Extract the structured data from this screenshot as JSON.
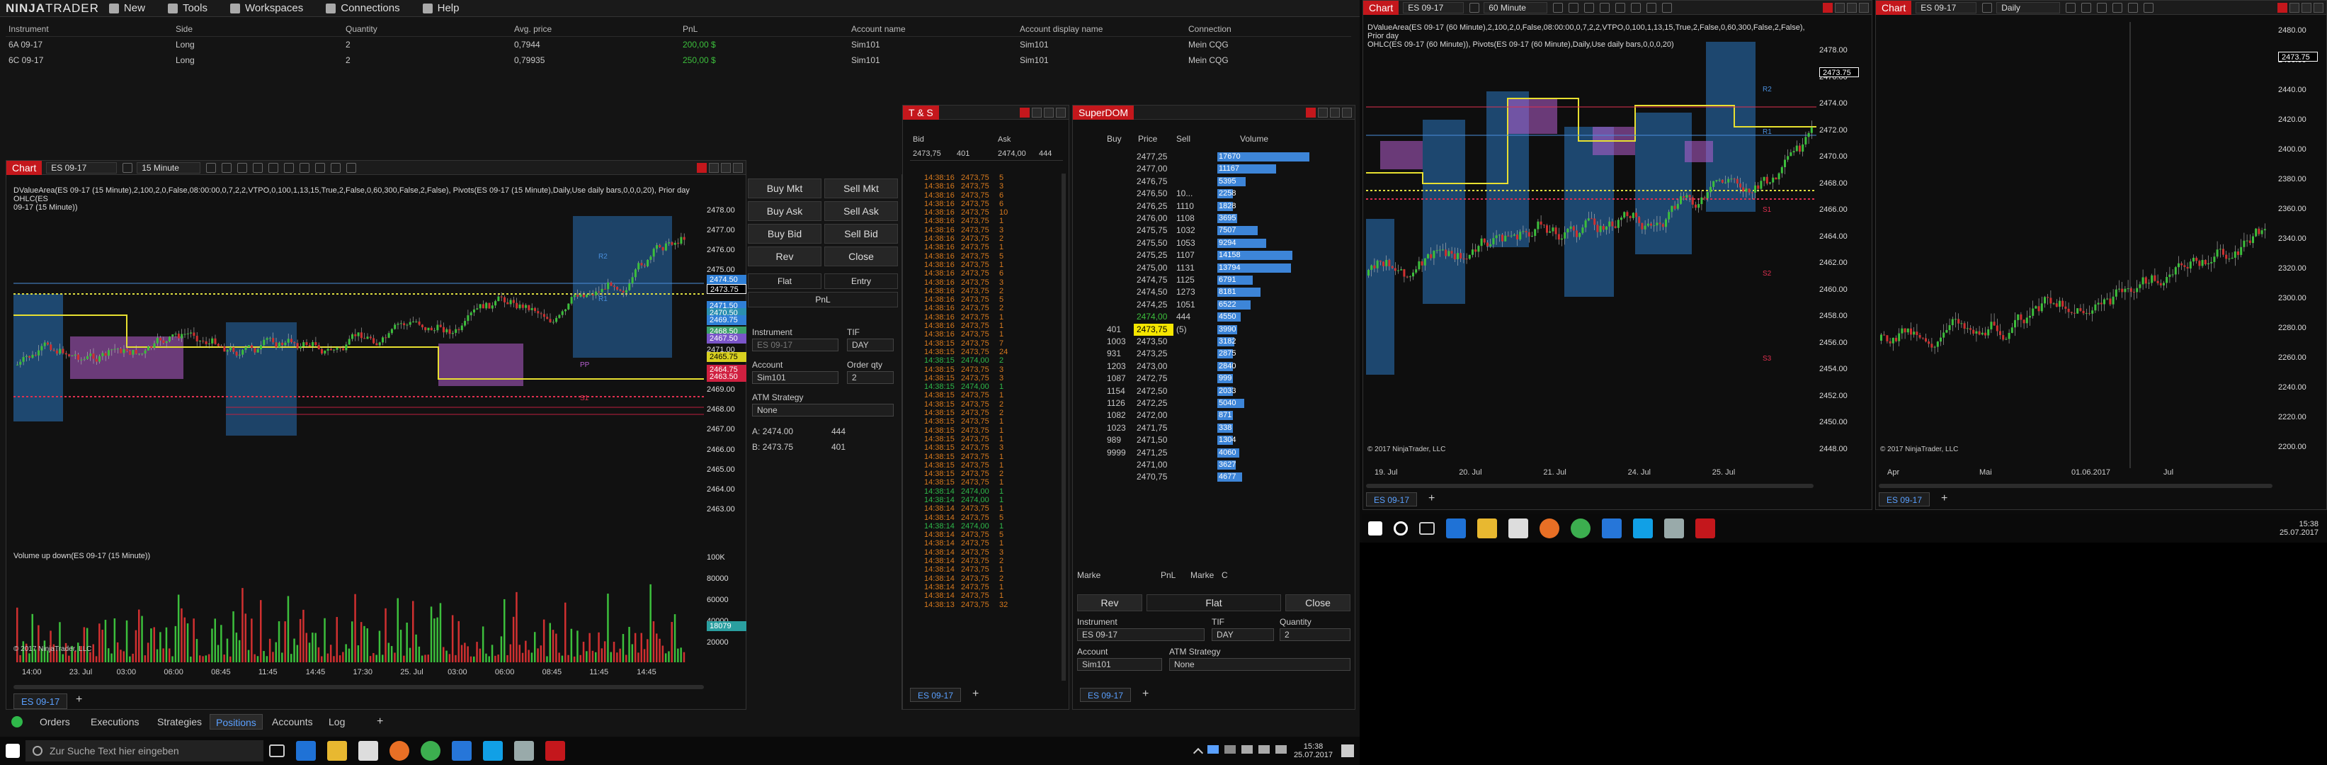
{
  "app": {
    "logo_a": "NINJA",
    "logo_b": "TRADER"
  },
  "menu": [
    {
      "label": "New",
      "icon": "new-icon"
    },
    {
      "label": "Tools",
      "icon": "tools-icon"
    },
    {
      "label": "Workspaces",
      "icon": "workspaces-icon"
    },
    {
      "label": "Connections",
      "icon": "connections-icon"
    },
    {
      "label": "Help",
      "icon": "help-icon"
    }
  ],
  "positions": {
    "columns": [
      "Instrument",
      "Side",
      "Quantity",
      "Avg. price",
      "PnL",
      "Account name",
      "Account display name",
      "Connection"
    ],
    "rows": [
      [
        "6A 09-17",
        "Long",
        "2",
        "0,7944",
        "200,00 $",
        "Sim101",
        "Sim101",
        "Mein CQG"
      ],
      [
        "6C 09-17",
        "Long",
        "2",
        "0,79935",
        "250,00 $",
        "Sim101",
        "Sim101",
        "Mein CQG"
      ]
    ]
  },
  "chart1": {
    "title": "Chart",
    "instrument": "ES 09-17",
    "interval": "15 Minute",
    "indicator_text_1": "DValueArea(ES 09-17 (15 Minute),2,100,2,0,False,08:00:00,0,7,2,2,VTPO,0,100,1,13,15,True,2,False,0,60,300,False,2,False), Pivots(ES 09-17 (15 Minute),Daily,Use daily bars,0,0,0,20), Prior day OHLC(ES",
    "indicator_text_2": "09-17 (15 Minute))",
    "volume_label": "Volume up down(ES 09-17 (15 Minute))",
    "copyright": "© 2017 NinjaTrader, LLC",
    "tab_label": "ES 09-17",
    "price_ticks": [
      "2478.00",
      "2477.00",
      "2476.00",
      "2475.00",
      "2474.00",
      "2473.00",
      "2472.00",
      "2471.00",
      "2470.00",
      "2469.00",
      "2468.00",
      "2467.00",
      "2466.00",
      "2465.00",
      "2464.00",
      "2463.00"
    ],
    "badges": [
      {
        "text": "2474.50",
        "color": "#2f7fd6"
      },
      {
        "text": "2473.75",
        "color": "#000000"
      },
      {
        "text": "2471.50",
        "color": "#2f7fd6"
      },
      {
        "text": "2470.50",
        "color": "#2a8fb0"
      },
      {
        "text": "2469.75",
        "color": "#2f7fd6"
      },
      {
        "text": "2468.50",
        "color": "#3ca06a"
      },
      {
        "text": "2467.50",
        "color": "#7a55c8"
      },
      {
        "text": "2465.75",
        "color": "#d8d020"
      },
      {
        "text": "2464.75",
        "color": "#d02040"
      },
      {
        "text": "2463.50",
        "color": "#d02040"
      }
    ],
    "vol_ticks": [
      "100K",
      "80000",
      "60000",
      "40000",
      "20000"
    ],
    "vol_badge": "18079",
    "time_ticks": [
      "14:00",
      "23. Jul",
      "03:00",
      "06:00",
      "08:45",
      "11:45",
      "14:45",
      "17:30",
      "25. Jul",
      "03:00",
      "06:00",
      "08:45",
      "11:45",
      "14:45"
    ],
    "labels": {
      "r2": "R2",
      "r1": "R1",
      "pp": "PP",
      "s1": "S1"
    }
  },
  "order_panel": {
    "buy_mkt": "Buy Mkt",
    "sell_mkt": "Sell Mkt",
    "buy_ask": "Buy Ask",
    "sell_ask": "Sell Ask",
    "buy_bid": "Buy Bid",
    "sell_bid": "Sell Bid",
    "rev": "Rev",
    "close": "Close",
    "flat": "Flat",
    "entry": "Entry",
    "pnl": "PnL",
    "instrument_label": "Instrument",
    "instrument_value": "ES 09-17",
    "tif_label": "TIF",
    "tif_value": "DAY",
    "account_label": "Account",
    "account_value": "Sim101",
    "order_qty_label": "Order qty",
    "order_qty_value": "2",
    "atm_label": "ATM Strategy",
    "atm_value": "None",
    "a_label": "A:",
    "a_price": "2474.00",
    "a_size": "444",
    "b_label": "B:",
    "b_price": "2473.75",
    "b_size": "401"
  },
  "bottom_tabs": [
    "Orders",
    "Executions",
    "Strategies",
    "Positions",
    "Accounts",
    "Log"
  ],
  "ts": {
    "title": "T & S",
    "bid_label": "Bid",
    "ask_label": "Ask",
    "bid_price": "2473,75",
    "bid_size": "401",
    "ask_price": "2474,00",
    "ask_size": "444",
    "tab_label": "ES 09-17",
    "rows": [
      [
        "14:38:16",
        "2473,75",
        "5",
        "o"
      ],
      [
        "14:38:16",
        "2473,75",
        "3",
        "o"
      ],
      [
        "14:38:16",
        "2473,75",
        "6",
        "o"
      ],
      [
        "14:38:16",
        "2473,75",
        "6",
        "o"
      ],
      [
        "14:38:16",
        "2473,75",
        "10",
        "o"
      ],
      [
        "14:38:16",
        "2473,75",
        "1",
        "o"
      ],
      [
        "14:38:16",
        "2473,75",
        "3",
        "o"
      ],
      [
        "14:38:16",
        "2473,75",
        "2",
        "o"
      ],
      [
        "14:38:16",
        "2473,75",
        "1",
        "o"
      ],
      [
        "14:38:16",
        "2473,75",
        "5",
        "o"
      ],
      [
        "14:38:16",
        "2473,75",
        "1",
        "o"
      ],
      [
        "14:38:16",
        "2473,75",
        "6",
        "o"
      ],
      [
        "14:38:16",
        "2473,75",
        "3",
        "o"
      ],
      [
        "14:38:16",
        "2473,75",
        "2",
        "o"
      ],
      [
        "14:38:16",
        "2473,75",
        "5",
        "o"
      ],
      [
        "14:38:16",
        "2473,75",
        "2",
        "o"
      ],
      [
        "14:38:16",
        "2473,75",
        "1",
        "o"
      ],
      [
        "14:38:16",
        "2473,75",
        "1",
        "o"
      ],
      [
        "14:38:16",
        "2473,75",
        "1",
        "o"
      ],
      [
        "14:38:15",
        "2473,75",
        "7",
        "o"
      ],
      [
        "14:38:15",
        "2473,75",
        "24",
        "o"
      ],
      [
        "14:38:15",
        "2474,00",
        "2",
        "g"
      ],
      [
        "14:38:15",
        "2473,75",
        "3",
        "o"
      ],
      [
        "14:38:15",
        "2473,75",
        "3",
        "o"
      ],
      [
        "14:38:15",
        "2474,00",
        "1",
        "g"
      ],
      [
        "14:38:15",
        "2473,75",
        "1",
        "o"
      ],
      [
        "14:38:15",
        "2473,75",
        "2",
        "o"
      ],
      [
        "14:38:15",
        "2473,75",
        "2",
        "o"
      ],
      [
        "14:38:15",
        "2473,75",
        "1",
        "o"
      ],
      [
        "14:38:15",
        "2473,75",
        "1",
        "o"
      ],
      [
        "14:38:15",
        "2473,75",
        "1",
        "o"
      ],
      [
        "14:38:15",
        "2473,75",
        "3",
        "o"
      ],
      [
        "14:38:15",
        "2473,75",
        "1",
        "o"
      ],
      [
        "14:38:15",
        "2473,75",
        "1",
        "o"
      ],
      [
        "14:38:15",
        "2473,75",
        "2",
        "o"
      ],
      [
        "14:38:15",
        "2473,75",
        "1",
        "o"
      ],
      [
        "14:38:14",
        "2474,00",
        "1",
        "g"
      ],
      [
        "14:38:14",
        "2474,00",
        "1",
        "g"
      ],
      [
        "14:38:14",
        "2473,75",
        "1",
        "o"
      ],
      [
        "14:38:14",
        "2473,75",
        "5",
        "o"
      ],
      [
        "14:38:14",
        "2474,00",
        "1",
        "g"
      ],
      [
        "14:38:14",
        "2473,75",
        "5",
        "o"
      ],
      [
        "14:38:14",
        "2473,75",
        "1",
        "o"
      ],
      [
        "14:38:14",
        "2473,75",
        "3",
        "o"
      ],
      [
        "14:38:14",
        "2473,75",
        "2",
        "o"
      ],
      [
        "14:38:14",
        "2473,75",
        "1",
        "o"
      ],
      [
        "14:38:14",
        "2473,75",
        "2",
        "o"
      ],
      [
        "14:38:14",
        "2473,75",
        "1",
        "o"
      ],
      [
        "14:38:14",
        "2473,75",
        "1",
        "o"
      ],
      [
        "14:38:13",
        "2473,75",
        "32",
        "o"
      ]
    ]
  },
  "dom": {
    "title": "SuperDOM",
    "headers": {
      "buy": "Buy",
      "price": "Price",
      "sell": "Sell",
      "volume": "Volume"
    },
    "rows": [
      {
        "buy": "",
        "price": "2477,25",
        "sell": "",
        "vol": "17670",
        "frac": 0.55
      },
      {
        "buy": "",
        "price": "2477,00",
        "sell": "",
        "vol": "11167",
        "frac": 0.35
      },
      {
        "buy": "",
        "price": "2476,75",
        "sell": "",
        "vol": "5395",
        "frac": 0.17
      },
      {
        "buy": "",
        "price": "2476,50",
        "sell": "10...",
        "vol": "2258",
        "frac": 0.07
      },
      {
        "buy": "",
        "price": "2476,25",
        "sell": "1110",
        "vol": "1828",
        "frac": 0.06
      },
      {
        "buy": "",
        "price": "2476,00",
        "sell": "1108",
        "vol": "3695",
        "frac": 0.12
      },
      {
        "buy": "",
        "price": "2475,75",
        "sell": "1032",
        "vol": "7507",
        "frac": 0.24
      },
      {
        "buy": "",
        "price": "2475,50",
        "sell": "1053",
        "vol": "9294",
        "frac": 0.29
      },
      {
        "buy": "",
        "price": "2475,25",
        "sell": "1107",
        "vol": "14158",
        "frac": 0.45
      },
      {
        "buy": "",
        "price": "2475,00",
        "sell": "1131",
        "vol": "13794",
        "frac": 0.44
      },
      {
        "buy": "",
        "price": "2474,75",
        "sell": "1125",
        "vol": "6791",
        "frac": 0.21
      },
      {
        "buy": "",
        "price": "2474,50",
        "sell": "1273",
        "vol": "8181",
        "frac": 0.26
      },
      {
        "buy": "",
        "price": "2474,25",
        "sell": "1051",
        "vol": "6522",
        "frac": 0.2
      },
      {
        "buy": "",
        "price": "2474,00",
        "sell": "444",
        "vol": "4550",
        "frac": 0.14
      },
      {
        "buy": "401",
        "price": "2473,75",
        "sell": "(5)",
        "vol": "3990",
        "frac": 0.12
      },
      {
        "buy": "1003",
        "price": "2473,50",
        "sell": "",
        "vol": "3182",
        "frac": 0.1
      },
      {
        "buy": "931",
        "price": "2473,25",
        "sell": "",
        "vol": "2875",
        "frac": 0.09
      },
      {
        "buy": "1203",
        "price": "2473,00",
        "sell": "",
        "vol": "2840",
        "frac": 0.09
      },
      {
        "buy": "1087",
        "price": "2472,75",
        "sell": "",
        "vol": "999",
        "frac": 0.03
      },
      {
        "buy": "1154",
        "price": "2472,50",
        "sell": "",
        "vol": "2033",
        "frac": 0.06
      },
      {
        "buy": "1126",
        "price": "2472,25",
        "sell": "",
        "vol": "5040",
        "frac": 0.16
      },
      {
        "buy": "1082",
        "price": "2472,00",
        "sell": "",
        "vol": "871",
        "frac": 0.03
      },
      {
        "buy": "1023",
        "price": "2471,75",
        "sell": "",
        "vol": "338",
        "frac": 0.01
      },
      {
        "buy": "989",
        "price": "2471,50",
        "sell": "",
        "vol": "1304",
        "frac": 0.04
      },
      {
        "buy": "9999",
        "price": "2471,25",
        "sell": "",
        "vol": "4060",
        "frac": 0.13
      },
      {
        "buy": "",
        "price": "2471,00",
        "sell": "",
        "vol": "3627",
        "frac": 0.11
      },
      {
        "buy": "",
        "price": "2470,75",
        "sell": "",
        "vol": "4677",
        "frac": 0.15
      }
    ],
    "bottom_row": {
      "mkt1": "Marke",
      "pnl": "PnL",
      "mkt2": "Marke",
      "c": "C"
    },
    "rev": "Rev",
    "flat": "Flat",
    "close": "Close",
    "instrument_label": "Instrument",
    "instrument_value": "ES 09-17",
    "tif_label": "TIF",
    "tif_value": "DAY",
    "qty_label": "Quantity",
    "qty_value": "2",
    "account_label": "Account",
    "account_value": "Sim101",
    "atm_label": "ATM Strategy",
    "atm_value": "None",
    "tab_label": "ES 09-17"
  },
  "chart2": {
    "title": "Chart",
    "instrument": "ES 09-17",
    "interval": "60 Minute",
    "indicator_text_1": "DValueArea(ES 09-17 (60 Minute),2,100,2,0,False,08:00:00,0,7,2,2,VTPO,0,100,1,13,15,True,2,False,0,60,300,False,2,False), Prior day",
    "indicator_text_2": "OHLC(ES 09-17 (60 Minute)), Pivots(ES 09-17 (60 Minute),Daily,Use daily bars,0,0,0,20)",
    "price_ticks": [
      "2478.00",
      "2476.00",
      "2474.00",
      "2472.00",
      "2470.00",
      "2468.00",
      "2466.00",
      "2464.00",
      "2462.00",
      "2460.00",
      "2458.00",
      "2456.00",
      "2454.00",
      "2452.00",
      "2450.00",
      "2448.00"
    ],
    "last_badge": "2473.75",
    "time_ticks": [
      "19. Jul",
      "20. Jul",
      "21. Jul",
      "24. Jul",
      "25. Jul"
    ],
    "copyright": "© 2017 NinjaTrader, LLC",
    "tab_label": "ES 09-17",
    "labels": {
      "r2": "R2",
      "r1": "R1",
      "s1": "S1",
      "s2": "S2",
      "s3": "S3"
    }
  },
  "chart3": {
    "title": "Chart",
    "instrument": "ES 09-17",
    "interval": "Daily",
    "price_ticks": [
      "2480.00",
      "2460.00",
      "2440.00",
      "2420.00",
      "2400.00",
      "2380.00",
      "2360.00",
      "2340.00",
      "2320.00",
      "2300.00",
      "2280.00",
      "2260.00",
      "2240.00",
      "2220.00",
      "2200.00"
    ],
    "last_badge": "2473.75",
    "time_ticks": [
      "Apr",
      "Mai",
      "01.06.2017",
      "Jul"
    ],
    "copyright": "© 2017 NinjaTrader, LLC",
    "tab_label": "ES 09-17"
  },
  "taskbar1": {
    "search": "Zur Suche Text hier eingeben",
    "time": "15:38",
    "date": "25.07.2017"
  },
  "taskbar2": {
    "time": "15:38",
    "date": "25.07.2017"
  }
}
